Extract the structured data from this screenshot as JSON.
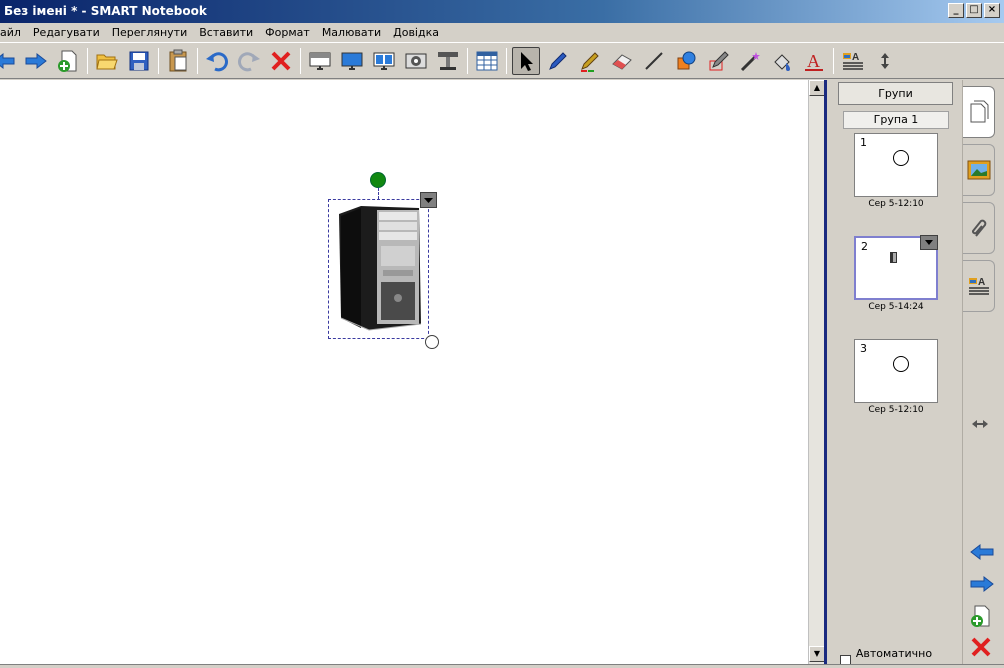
{
  "window": {
    "title": "Без імені * - SMART Notebook",
    "controls": [
      "_",
      "□",
      "×"
    ]
  },
  "menu": {
    "items": [
      "айл",
      "Редагувати",
      "Переглянути",
      "Вставити",
      "Формат",
      "Малювати",
      "Довідка"
    ]
  },
  "toolbar": {
    "buttons": [
      "back-icon",
      "forward-icon",
      "add-page-icon",
      "open-icon",
      "save-icon",
      "paste-icon",
      "undo-icon",
      "redo-icon",
      "delete-icon",
      "screen-shade-icon",
      "full-screen-icon",
      "dual-display-icon",
      "capture-icon",
      "doc-camera-icon",
      "table-icon",
      "select-icon",
      "pen-icon",
      "creative-pen-icon",
      "eraser-icon",
      "line-icon",
      "shapes-icon",
      "magic-pen-icon",
      "magic-wand-icon",
      "fill-icon",
      "text-icon",
      "properties-icon",
      "move-toolbar-icon"
    ]
  },
  "sidepanel": {
    "groups_button": "Групи",
    "group_label": "Група 1",
    "pages": [
      {
        "number": "1",
        "time": "Сер 5-12:10",
        "selected": false
      },
      {
        "number": "2",
        "time": "Сер 5-14:24",
        "selected": true
      },
      {
        "number": "3",
        "time": "Сер 5-12:10",
        "selected": false
      }
    ],
    "autohide_label": "Автоматично прих"
  },
  "colors": {
    "accent": "#0a246a",
    "selection": "#3a3aa0",
    "rotate_handle": "#118811"
  }
}
